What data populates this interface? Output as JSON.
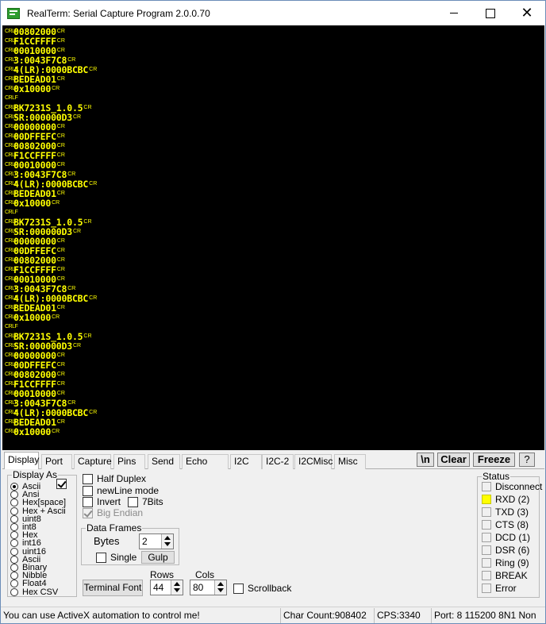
{
  "window": {
    "title": "RealTerm: Serial Capture Program 2.0.0.70",
    "minimize": "",
    "maximize": "",
    "close": "✕"
  },
  "terminal": {
    "crlf_glyph": "CRLF",
    "cr_glyph": "CR",
    "lines": [
      {
        "text": "00802000",
        "cr": true
      },
      {
        "text": "F1CCFFFF",
        "cr": true
      },
      {
        "text": "00010000",
        "cr": true
      },
      {
        "text": "3:0043F7C8",
        "cr": true
      },
      {
        "text": "4(LR):0000BCBC",
        "cr": true
      },
      {
        "text": "BEDEAD01",
        "cr": true
      },
      {
        "text": "0x10000",
        "cr": true
      },
      {
        "text": "",
        "cr": false
      },
      {
        "text": "BK7231S_1.0.5",
        "cr": true
      },
      {
        "text": "SR:000000D3",
        "cr": true
      },
      {
        "text": "00000000",
        "cr": true
      },
      {
        "text": "00DFFEFC",
        "cr": true
      },
      {
        "text": "00802000",
        "cr": true
      },
      {
        "text": "F1CCFFFF",
        "cr": true
      },
      {
        "text": "00010000",
        "cr": true
      },
      {
        "text": "3:0043F7C8",
        "cr": true
      },
      {
        "text": "4(LR):0000BCBC",
        "cr": true
      },
      {
        "text": "BEDEAD01",
        "cr": true
      },
      {
        "text": "0x10000",
        "cr": true
      },
      {
        "text": "",
        "cr": false
      },
      {
        "text": "BK7231S_1.0.5",
        "cr": true
      },
      {
        "text": "SR:000000D3",
        "cr": true
      },
      {
        "text": "00000000",
        "cr": true
      },
      {
        "text": "00DFFEFC",
        "cr": true
      },
      {
        "text": "00802000",
        "cr": true
      },
      {
        "text": "F1CCFFFF",
        "cr": true
      },
      {
        "text": "00010000",
        "cr": true
      },
      {
        "text": "3:0043F7C8",
        "cr": true
      },
      {
        "text": "4(LR):0000BCBC",
        "cr": true
      },
      {
        "text": "BEDEAD01",
        "cr": true
      },
      {
        "text": "0x10000",
        "cr": true
      },
      {
        "text": "",
        "cr": false
      },
      {
        "text": "BK7231S_1.0.5",
        "cr": true
      },
      {
        "text": "SR:000000D3",
        "cr": true
      },
      {
        "text": "00000000",
        "cr": true
      },
      {
        "text": "00DFFEFC",
        "cr": true
      },
      {
        "text": "00802000",
        "cr": true
      },
      {
        "text": "F1CCFFFF",
        "cr": true
      },
      {
        "text": "00010000",
        "cr": true
      },
      {
        "text": "3:0043F7C8",
        "cr": true
      },
      {
        "text": "4(LR):0000BCBC",
        "cr": true
      },
      {
        "text": "BEDEAD01",
        "cr": true
      },
      {
        "text": "0x10000",
        "cr": true
      }
    ],
    "colors": {
      "background": "#000000",
      "text": "#ffff00"
    }
  },
  "tabs": [
    "Display",
    "Port",
    "Capture",
    "Pins",
    "Send",
    "Echo Port",
    "I2C",
    "I2C-2",
    "I2CMisc",
    "Misc"
  ],
  "active_tab": "Display",
  "toolbar": {
    "newline_btn": "\\n",
    "clear_btn": "Clear",
    "freeze_btn": "Freeze",
    "help_btn": "?"
  },
  "display_as": {
    "label": "Display As",
    "options": [
      "Ascii",
      "Ansi",
      "Hex[space]",
      "Hex + Ascii",
      "uint8",
      "int8",
      "Hex",
      "int16",
      "uint16",
      "Ascii",
      "Binary",
      "Nibble",
      "Float4",
      "Hex CSV"
    ],
    "selected": "Ascii",
    "checkbox_checked": true
  },
  "options": {
    "half_duplex": {
      "label": "Half Duplex",
      "checked": false
    },
    "newline_mode": {
      "label": "newLine mode",
      "checked": false
    },
    "invert": {
      "label": "Invert",
      "checked": false
    },
    "seven_bits": {
      "label": "7Bits",
      "checked": false
    },
    "big_endian": {
      "label": "Big Endian",
      "checked": true
    }
  },
  "data_frames": {
    "label": "Data Frames",
    "bytes_label": "Bytes",
    "bytes_value": "2",
    "single_label": "Single",
    "single_checked": false,
    "gulp_btn": "Gulp"
  },
  "terminal_font_btn": "Terminal Font",
  "rows": {
    "label": "Rows",
    "value": "44"
  },
  "cols": {
    "label": "Cols",
    "value": "80"
  },
  "scrollback": {
    "label": "Scrollback",
    "checked": false
  },
  "status": {
    "label": "Status",
    "items": [
      {
        "label": "Disconnect",
        "on": false
      },
      {
        "label": "RXD (2)",
        "on": true
      },
      {
        "label": "TXD (3)",
        "on": false
      },
      {
        "label": "CTS (8)",
        "on": false
      },
      {
        "label": "DCD (1)",
        "on": false
      },
      {
        "label": "DSR (6)",
        "on": false
      },
      {
        "label": "Ring (9)",
        "on": false
      },
      {
        "label": "BREAK",
        "on": false
      },
      {
        "label": "Error",
        "on": false
      }
    ],
    "led_on_color": "#ffff00"
  },
  "statusbar": {
    "message": "You can use ActiveX automation to control me!",
    "char_count": "Char Count:908402",
    "cps": "CPS:3340",
    "port": "Port: 8 115200 8N1 Non"
  }
}
